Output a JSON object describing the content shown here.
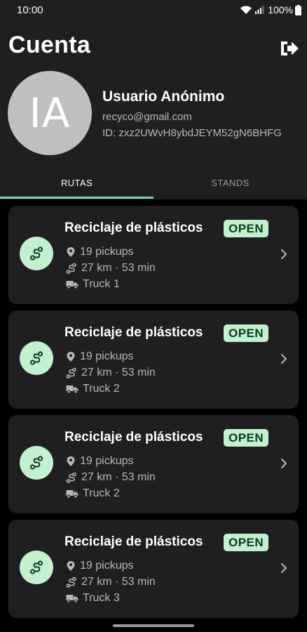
{
  "status_bar": {
    "time": "10:00",
    "battery": "100%"
  },
  "header": {
    "title": "Cuenta"
  },
  "profile": {
    "initials": "IA",
    "name": "Usuario Anónimo",
    "email": "recyco@gmail.com",
    "id": "ID: zxz2UWvH8ybdJEYM52gN6BHFG"
  },
  "tabs": [
    {
      "label": "RUTAS",
      "selected": true
    },
    {
      "label": "STANDS",
      "selected": false
    }
  ],
  "routes": [
    {
      "title": "Reciclaje de plásticos",
      "status": "OPEN",
      "pickups": "19 pickups",
      "distance": "27 km · 53 min",
      "truck": "Truck 1"
    },
    {
      "title": "Reciclaje de plásticos",
      "status": "OPEN",
      "pickups": "19 pickups",
      "distance": "27 km · 53 min",
      "truck": "Truck 2"
    },
    {
      "title": "Reciclaje de plásticos",
      "status": "OPEN",
      "pickups": "19 pickups",
      "distance": "27 km · 53 min",
      "truck": "Truck 2"
    },
    {
      "title": "Reciclaje de plásticos",
      "status": "OPEN",
      "pickups": "19 pickups",
      "distance": "27 km · 53 min",
      "truck": "Truck 3"
    }
  ],
  "colors": {
    "accent": "#c3f0cf",
    "tab_indicator": "#7fd3a8",
    "surface": "#1f1f22",
    "background": "#000000"
  },
  "icons": {
    "logout": "logout-icon",
    "route": "route-icon",
    "pickups": "location-pin-icon",
    "distance": "route-distance-icon",
    "truck": "truck-icon",
    "chevron": "chevron-right-icon"
  }
}
